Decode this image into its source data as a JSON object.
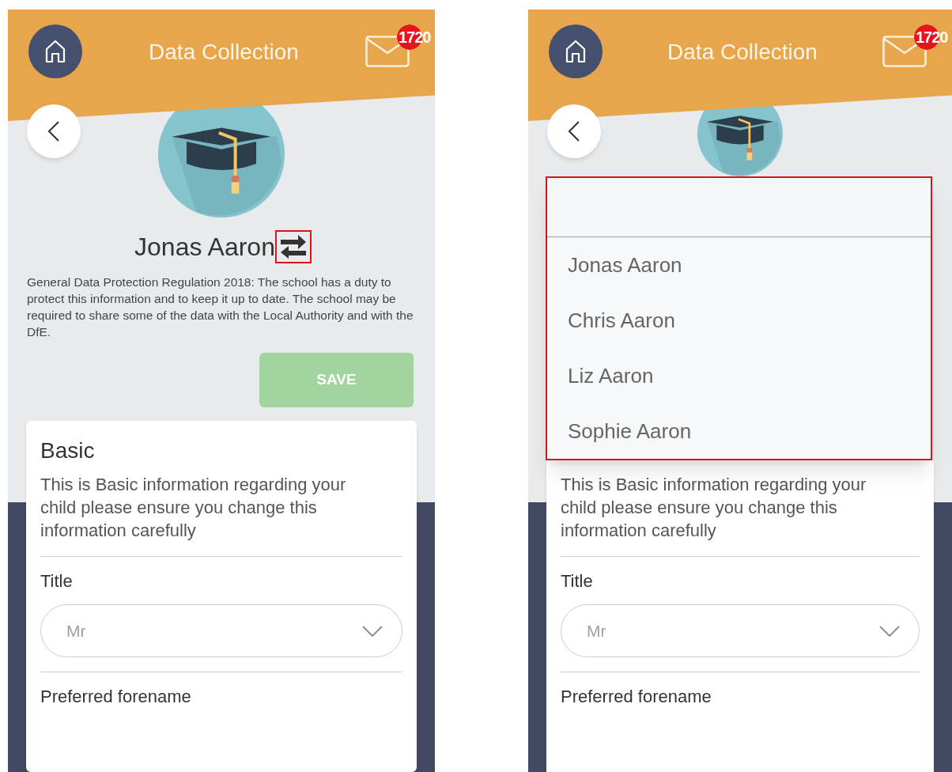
{
  "screens": [
    {
      "header": {
        "title": "Data Collection",
        "badge_count": "1720"
      },
      "student": {
        "name": "Jonas Aaron",
        "switch_highlighted": true
      },
      "notice": "General Data Protection Regulation 2018: The school has a duty to protect this information and to keep it up to date. The school may be required to share some of the data with the Local Authority and with the DfE.",
      "save_button": {
        "label": "SAVE",
        "disabled": true
      },
      "section": {
        "title": "Basic",
        "description": "This is Basic information regarding your child please ensure you change this information carefully",
        "fields": [
          {
            "label": "Title",
            "kind": "select",
            "value": "Mr"
          },
          {
            "label": "Preferred forename",
            "kind": "text"
          }
        ]
      }
    },
    {
      "header": {
        "title": "Data Collection",
        "badge_count": "1720"
      },
      "student_menu": {
        "highlighted": true,
        "options": [
          {
            "label": "Jonas Aaron",
            "selected": false
          },
          {
            "label": "Chris Aaron",
            "selected": false
          },
          {
            "label": "Liz Aaron",
            "selected": false
          },
          {
            "label": "Sophie Aaron",
            "selected": false
          }
        ]
      },
      "section": {
        "description": "This is Basic information regarding your child please ensure you change this information carefully",
        "fields": [
          {
            "label": "Title",
            "kind": "select",
            "value": "Mr"
          },
          {
            "label": "Preferred forename",
            "kind": "text"
          }
        ]
      }
    }
  ]
}
